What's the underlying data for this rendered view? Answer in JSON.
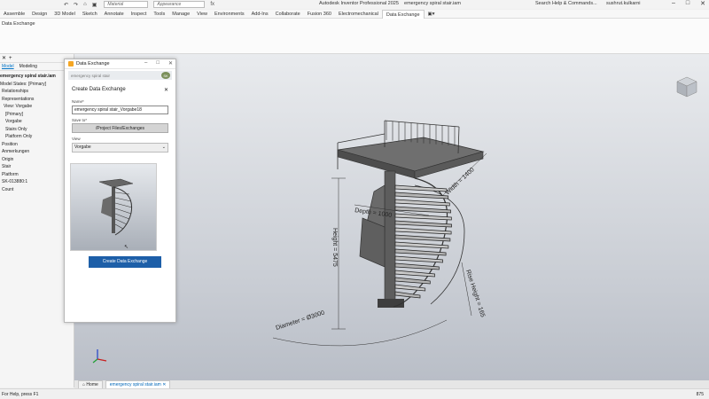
{
  "titlebar": {
    "app_title": "Autodesk Inventor Professional 2025",
    "doc_title": "emergency spiral stair.iam",
    "material_placeholder": "Material",
    "appearance_placeholder": "Appearance",
    "search_placeholder": "Search Help & Commands...",
    "user": "sushrut.kulkarni"
  },
  "ribbon": {
    "tabs": [
      "Assemble",
      "Design",
      "3D Model",
      "Sketch",
      "Annotate",
      "Inspect",
      "Tools",
      "Manage",
      "View",
      "Environments",
      "Add-Ins",
      "Collaborate",
      "Fusion 360",
      "Electromechanical",
      "Data Exchange"
    ],
    "active_tab": "Data Exchange",
    "panel_label": "Data Exchange"
  },
  "browser": {
    "tabs": [
      "Model",
      "Modeling"
    ],
    "items": [
      {
        "label": "emergency spiral stair.iam",
        "bold": true
      },
      {
        "label": "Model States: [Primary]"
      },
      {
        "label": "Relationships"
      },
      {
        "label": "Representations"
      },
      {
        "label": "View: Vorgabe"
      },
      {
        "label": "[Primary]"
      },
      {
        "label": "Vorgabe"
      },
      {
        "label": "Stairs Only"
      },
      {
        "label": "Platform Only"
      },
      {
        "label": "Position"
      },
      {
        "label": "Anmerkungen"
      },
      {
        "label": "Origin"
      },
      {
        "label": "Stair"
      },
      {
        "label": "Platform"
      },
      {
        "label": "SK-013880:1"
      },
      {
        "label": "Count"
      }
    ]
  },
  "dialog": {
    "window_title": "Data Exchange",
    "subtitle": "emergency spiral stair",
    "heading": "Create Data Exchange",
    "name_label": "Name*",
    "name_value": "emergency spiral stair_Vorgabe18",
    "save_to_label": "Save to*",
    "save_to_value": "/Project Files/Exchanges",
    "view_label": "View",
    "view_value": "Vorgabe",
    "create_button": "Create Data Exchange"
  },
  "dimensions": {
    "depth": "Depth = 1000",
    "width": "Width = 1400",
    "height": "Height = 5475",
    "diameter": "Diameter = Ø3000",
    "rise": "Rise Height = 165"
  },
  "doc_tabs": [
    "Home",
    "emergency spiral stair.iam"
  ],
  "status": {
    "text": "For Help, press F1",
    "count": "875"
  },
  "colors": {
    "accent": "#1d5fa8",
    "viewport_top": "#e9ebee",
    "viewport_bottom": "#b9bec7"
  }
}
